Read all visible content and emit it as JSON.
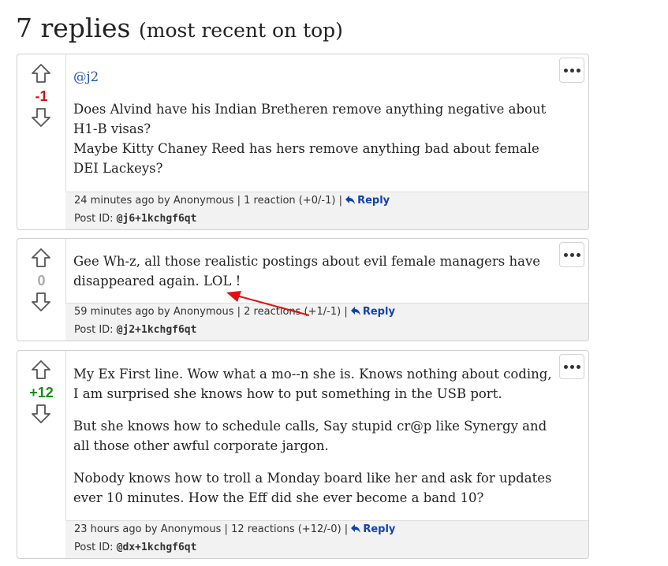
{
  "heading": {
    "count": "7 replies",
    "note": "(most recent on top)"
  },
  "posts": [
    {
      "score": "-1",
      "mention": "@j2",
      "lines": [
        "Does Alvind have his Indian Bretheren remove anything negative about H1-B visas?",
        "Maybe Kitty Chaney Reed has hers remove anything bad about female DEI Lackeys?"
      ],
      "time": "24 minutes ago",
      "author": "by Anonymous",
      "reactions": "1 reaction (+0/-1)",
      "reply_label": "Reply",
      "post_id_label": "Post ID:",
      "post_id": "@j6+1kchgf6qt"
    },
    {
      "score": "0",
      "paragraphs": [
        "Gee Wh-z, all those realistic postings about evil female managers have disappeared again. LOL !"
      ],
      "time": "59 minutes ago",
      "author": "by Anonymous",
      "reactions": "2 reactions (+1/-1)",
      "reply_label": "Reply",
      "post_id_label": "Post ID:",
      "post_id": "@j2+1kchgf6qt"
    },
    {
      "score": "+12",
      "paragraphs": [
        "My Ex First line. Wow what a mo--n she is. Knows nothing about coding, I am surprised she knows how to put something in the USB port.",
        "But she knows how to schedule calls, Say stupid cr@p like Synergy and all those other awful corporate jargon.",
        "Nobody knows how to troll a Monday board like her and ask for updates ever 10 minutes. How the Eff did she ever become a band 10?"
      ],
      "time": "23 hours ago",
      "author": "by Anonymous",
      "reactions": "12 reactions (+12/-0)",
      "reply_label": "Reply",
      "post_id_label": "Post ID:",
      "post_id": "@dx+1kchgf6qt"
    }
  ],
  "colors": {
    "negative": "#d01010",
    "positive": "#1a8a1a",
    "neutral": "#aaaaaa",
    "link": "#1144aa",
    "annotation_arrow": "#e01010"
  },
  "icons": {
    "upvote": "arrow-up-outline-icon",
    "downvote": "arrow-down-outline-icon",
    "menu": "ellipsis-icon",
    "reply": "reply-arrow-icon"
  }
}
